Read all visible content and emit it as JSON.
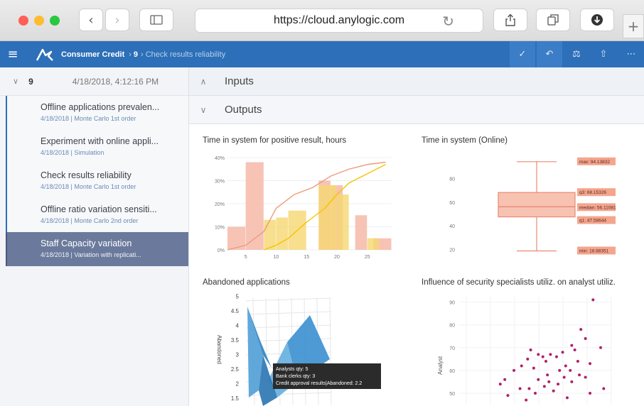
{
  "browser": {
    "url": "https://cloud.anylogic.com",
    "colors": {
      "close": "#ff5f57",
      "minimize": "#febc2e",
      "zoom": "#28c840"
    }
  },
  "appbar": {
    "app_name": "Consumer Credit",
    "crumb_number": "9",
    "crumb_page": "Check results reliability",
    "accent": "#2d6fb8"
  },
  "sidebar": {
    "header": {
      "number": "9",
      "timestamp": "4/18/2018, 4:12:16 PM"
    },
    "items": [
      {
        "title": "Offline applications prevalen...",
        "subtitle": "4/18/2018 | Monte Carlo 1st order"
      },
      {
        "title": "Experiment with online appli...",
        "subtitle": "4/18/2018 | Simulation"
      },
      {
        "title": "Check results reliability",
        "subtitle": "4/18/2018 | Monte Carlo 1st order"
      },
      {
        "title": "Offline ratio variation sensiti...",
        "subtitle": "4/18/2018 | Monte Carlo 2nd order"
      },
      {
        "title": "Staff Capacity variation",
        "subtitle": "4/18/2018 | Variation with replicati..."
      }
    ]
  },
  "sections": {
    "inputs": "Inputs",
    "outputs": "Outputs"
  },
  "panels": {
    "histogram_title": "Time in system for positive result, hours",
    "boxplot_title": "Time in system (Online)",
    "surface_title": "Abandoned applications",
    "scatter_title": "Influence of security specialists utiliz. on analyst utiliz."
  },
  "chart_data": [
    {
      "type": "bar",
      "title": "Time in system for positive result, hours",
      "x_ticks": [
        "5",
        "10",
        "15",
        "20",
        "25"
      ],
      "y_ticks": [
        "0%",
        "10%",
        "20%",
        "30%",
        "40%"
      ],
      "ylim": [
        0,
        40
      ],
      "xlim": [
        2,
        29
      ],
      "series": [
        {
          "color": "#f6b8a8",
          "bins": [
            [
              2,
              5,
              10
            ],
            [
              5,
              8,
              38
            ],
            [
              10,
              13,
              0
            ],
            [
              13,
              16,
              0
            ],
            [
              17,
              19,
              30
            ],
            [
              19,
              21,
              28
            ],
            [
              21,
              23,
              0
            ],
            [
              23,
              25,
              15
            ],
            [
              26,
              29,
              5
            ]
          ]
        },
        {
          "color": "#f5d770",
          "bins": [
            [
              8,
              10,
              13
            ],
            [
              10,
              12,
              14
            ],
            [
              12,
              15,
              17
            ],
            [
              15,
              17,
              0
            ],
            [
              17,
              20,
              28
            ],
            [
              20,
              22,
              24
            ],
            [
              22,
              24,
              0
            ],
            [
              25,
              27,
              5
            ]
          ]
        }
      ],
      "cumulative_lines": [
        {
          "color": "#ee9a7c",
          "x": [
            2,
            5,
            8,
            10,
            13,
            16,
            19,
            22,
            25,
            28
          ],
          "y": [
            0,
            2,
            8,
            18,
            24,
            27,
            32,
            35,
            37,
            38
          ]
        },
        {
          "color": "#f5c400",
          "x": [
            8,
            10,
            12,
            15,
            18,
            20,
            22,
            25,
            28
          ],
          "y": [
            0,
            2,
            5,
            12,
            18,
            24,
            29,
            33,
            37
          ]
        }
      ]
    },
    {
      "type": "boxplot",
      "title": "Time in system (Online)",
      "y_ticks": [
        "20",
        "40",
        "60",
        "80"
      ],
      "ylim": [
        15,
        100
      ],
      "box": {
        "min": 18.88351,
        "q1": 47.58644,
        "median": 56.11081,
        "q3": 68.15326,
        "max": 94.13832
      },
      "labels": {
        "max": "max: 94.13832",
        "q3": "q3: 68.15326",
        "median": "median: 56.11081",
        "q1": "q1: 47.58644",
        "min": "min: 18.88351"
      }
    },
    {
      "type": "surface",
      "title": "Abandoned applications",
      "z_label": "Abandoned",
      "z_ticks": [
        "1.5",
        "2",
        "2.5",
        "3",
        "3.5",
        "4",
        "4.5",
        "5"
      ],
      "tooltip": [
        "Analysts qty: 5",
        "Bank clerks qty: 3",
        "Credit approval results|Abandoned: 2.2"
      ]
    },
    {
      "type": "scatter",
      "title": "Influence of security specialists utiliz. on analyst utiliz.",
      "ylabel": "Analyst",
      "y_ticks": [
        "50",
        "60",
        "70",
        "80",
        "90"
      ],
      "ylim": [
        45,
        93
      ],
      "xlim": [
        0,
        1
      ],
      "color": "#b0206a",
      "points": [
        [
          0.88,
          91
        ],
        [
          0.8,
          78
        ],
        [
          0.83,
          74
        ],
        [
          0.93,
          70
        ],
        [
          0.74,
          71
        ],
        [
          0.76,
          69
        ],
        [
          0.68,
          68
        ],
        [
          0.6,
          67
        ],
        [
          0.47,
          69
        ],
        [
          0.52,
          67
        ],
        [
          0.55,
          66
        ],
        [
          0.64,
          66
        ],
        [
          0.57,
          64
        ],
        [
          0.45,
          65
        ],
        [
          0.78,
          64
        ],
        [
          0.86,
          63
        ],
        [
          0.7,
          62
        ],
        [
          0.73,
          60
        ],
        [
          0.41,
          62
        ],
        [
          0.49,
          61
        ],
        [
          0.66,
          60
        ],
        [
          0.58,
          58
        ],
        [
          0.79,
          58
        ],
        [
          0.69,
          57
        ],
        [
          0.83,
          57
        ],
        [
          0.36,
          60
        ],
        [
          0.52,
          56
        ],
        [
          0.59,
          55
        ],
        [
          0.74,
          55
        ],
        [
          0.65,
          54
        ],
        [
          0.46,
          52
        ],
        [
          0.56,
          53
        ],
        [
          0.4,
          52
        ],
        [
          0.3,
          56
        ],
        [
          0.27,
          54
        ],
        [
          0.62,
          51
        ],
        [
          0.5,
          50
        ],
        [
          0.86,
          50
        ],
        [
          0.95,
          52
        ],
        [
          0.32,
          49
        ],
        [
          0.71,
          48
        ],
        [
          0.44,
          47
        ]
      ]
    }
  ]
}
